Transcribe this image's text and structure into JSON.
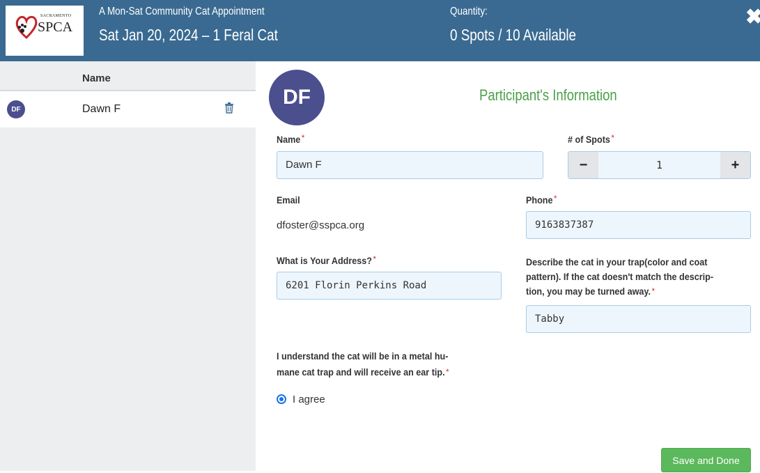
{
  "header": {
    "logo_small": "SACRAMENTO",
    "logo_big": "SPCA",
    "subtitle": "A Mon-Sat Community Cat Appointment",
    "title": "Sat Jan 20, 2024 – 1 Feral Cat",
    "quantity_label": "Quantity:",
    "quantity_value": "0 Spots / 10 Available",
    "close_icon": "✖"
  },
  "sidebar": {
    "column_header": "Name",
    "participants": [
      {
        "initials": "DF",
        "name": "Dawn F"
      }
    ]
  },
  "form": {
    "avatar_initials": "DF",
    "section_title": "Participant's Information",
    "required_mark": "*",
    "name_label": "Name",
    "name_value": "Dawn F",
    "spots_label": "# of Spots",
    "spots_value": "1",
    "minus": "−",
    "plus": "+",
    "email_label": "Email",
    "email_value": "dfoster@sspca.org",
    "phone_label": "Phone",
    "phone_value": "9163837387",
    "address_label": "What is Your Address?",
    "address_value": "6201 Florin Perkins Road",
    "cat_desc_label_1": "Describe the cat in your trap(color and coat",
    "cat_desc_label_2": "pattern). If the cat doesn't match the descrip-",
    "cat_desc_label_3": "tion, you may be turned away.",
    "cat_desc_value": "Tabby",
    "consent_label_1": "I understand the cat will be in a metal hu-",
    "consent_label_2": "mane cat trap and will receive an ear tip.",
    "agree_label": "I agree",
    "save_label": "Save and Done"
  },
  "colors": {
    "header_bg": "#3a6a91",
    "avatar": "#4b4f8e",
    "section_title": "#4aa04a",
    "save_button": "#5cb85c",
    "required": "#d9534f"
  }
}
